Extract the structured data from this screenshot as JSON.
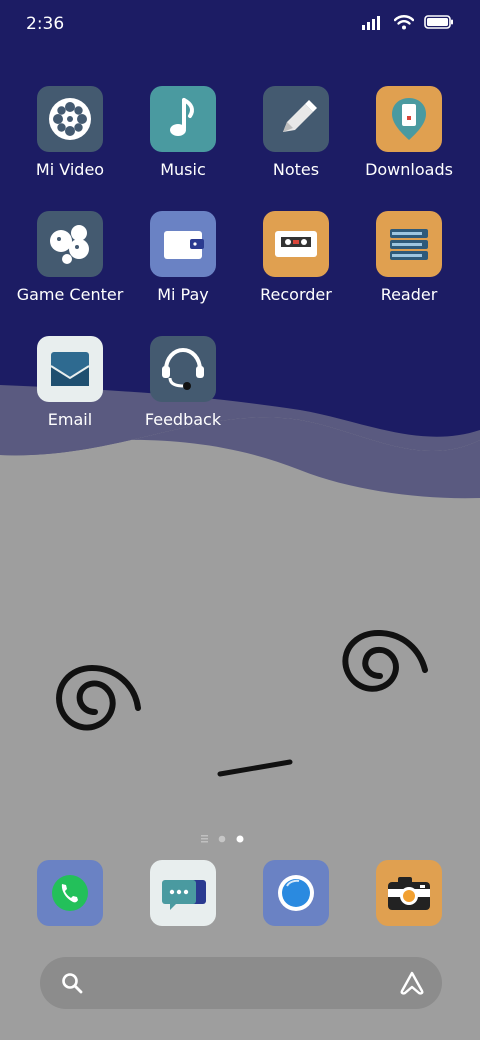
{
  "status_bar": {
    "time": "2:36"
  },
  "colors": {
    "sky": "#1c1c64",
    "wave_mid": "#5a5a80",
    "ground": "#9e9e9e",
    "tile_slate": "#445a70",
    "tile_teal": "#4a9aa0",
    "tile_orange": "#e0a050",
    "tile_blue": "#6a82c4",
    "tile_light": "#e8eeee"
  },
  "apps": [
    {
      "label": "Mi Video",
      "icon": "film-reel-icon"
    },
    {
      "label": "Music",
      "icon": "music-note-icon"
    },
    {
      "label": "Notes",
      "icon": "pencil-icon"
    },
    {
      "label": "Downloads",
      "icon": "download-phone-icon"
    },
    {
      "label": "Game Center",
      "icon": "game-bubbles-icon"
    },
    {
      "label": "Mi Pay",
      "icon": "wallet-icon"
    },
    {
      "label": "Recorder",
      "icon": "cassette-icon"
    },
    {
      "label": "Reader",
      "icon": "books-icon"
    },
    {
      "label": "Email",
      "icon": "envelope-icon"
    },
    {
      "label": "Feedback",
      "icon": "headset-icon"
    }
  ],
  "page_indicator": {
    "pages": 2,
    "current": 2
  },
  "dock": [
    {
      "name": "phone",
      "icon": "phone-icon"
    },
    {
      "name": "messages",
      "icon": "message-bubble-icon"
    },
    {
      "name": "browser",
      "icon": "browser-icon"
    },
    {
      "name": "camera",
      "icon": "camera-icon"
    }
  ]
}
